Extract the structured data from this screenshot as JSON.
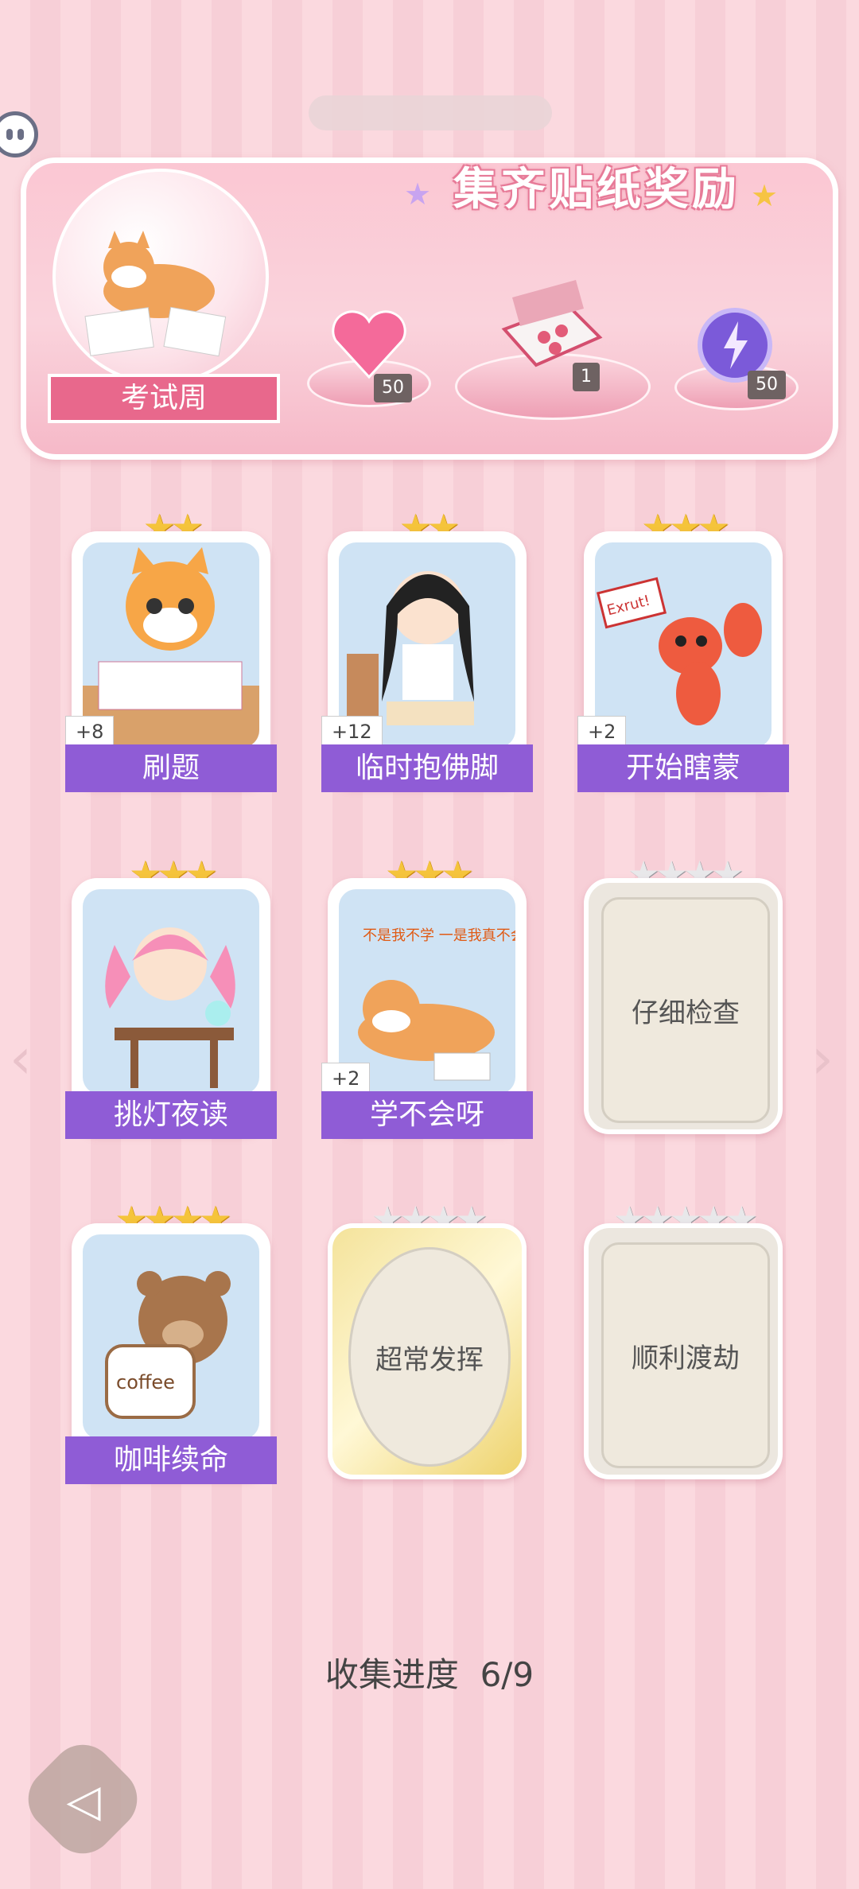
{
  "banner": {
    "title": "集齐贴纸奖励",
    "theme_label": "考试周",
    "rewards": [
      {
        "icon": "heart-gem-icon",
        "count": "50"
      },
      {
        "icon": "gift-box-icon",
        "count": "1"
      },
      {
        "icon": "energy-orb-icon",
        "count": "50"
      }
    ]
  },
  "stickers": [
    {
      "name": "刷题",
      "stars": 2,
      "bonus": "+8",
      "unlocked": true,
      "art": "cat-writing-icon"
    },
    {
      "name": "临时抱佛脚",
      "stars": 2,
      "bonus": "+12",
      "unlocked": true,
      "art": "girl-praying-icon"
    },
    {
      "name": "开始瞎蒙",
      "stars": 3,
      "bonus": "+2",
      "unlocked": true,
      "art": "lobster-sign-icon",
      "art_text": "Exrut!"
    },
    {
      "name": "挑灯夜读",
      "stars": 3,
      "bonus": "",
      "unlocked": true,
      "art": "girl-studying-icon"
    },
    {
      "name": "学不会呀",
      "stars": 3,
      "bonus": "+2",
      "unlocked": true,
      "art": "shiba-lying-icon",
      "art_text": "不是我不学 一是我真不会呀"
    },
    {
      "name": "仔细检查",
      "stars": 4,
      "bonus": "",
      "unlocked": false
    },
    {
      "name": "咖啡续命",
      "stars": 4,
      "bonus": "",
      "unlocked": true,
      "art": "bear-coffee-icon",
      "art_text": "coffee"
    },
    {
      "name": "超常发挥",
      "stars": 4,
      "bonus": "",
      "unlocked": false,
      "frame": "gold"
    },
    {
      "name": "顺利渡劫",
      "stars": 5,
      "bonus": "",
      "unlocked": false
    }
  ],
  "progress": {
    "label": "收集进度",
    "value": "6/9"
  },
  "colors": {
    "label_purple": "#8f5cd6",
    "banner_pink": "#fbc7d3",
    "star_gold": "#f5c43b"
  }
}
